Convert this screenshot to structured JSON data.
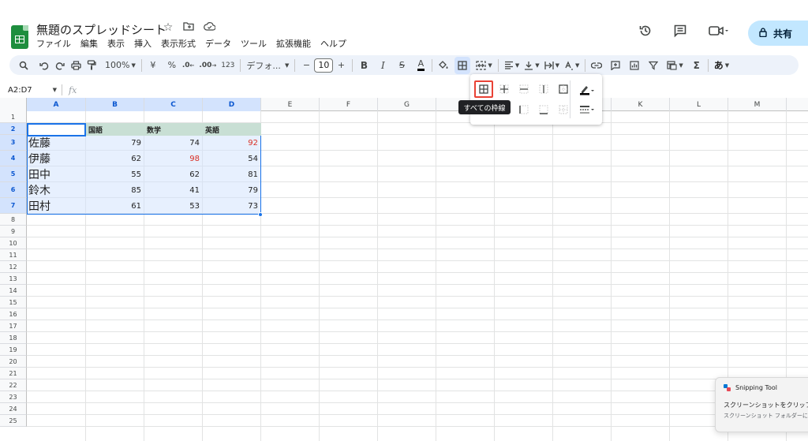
{
  "doc": {
    "title": "無題のスプレッドシート",
    "icons": [
      "star-icon",
      "move-to-folder-icon",
      "cloud-saved-icon"
    ]
  },
  "menu": [
    "ファイル",
    "編集",
    "表示",
    "挿入",
    "表示形式",
    "データ",
    "ツール",
    "拡張機能",
    "ヘルプ"
  ],
  "header_right": {
    "share_label": "共有",
    "icons": [
      "version-history-icon",
      "comments-icon",
      "meet-icon"
    ]
  },
  "toolbar": {
    "zoom": "100%",
    "currency": "¥",
    "percent": "%",
    "dec_minus": ".0",
    "dec_plus": ".00",
    "format_123": "123",
    "font": "デフォ...",
    "minus": "−",
    "font_size": "10",
    "plus": "+",
    "bold": "B",
    "italic": "I",
    "strike": "S",
    "text_color": "A",
    "ime": "あ"
  },
  "formula_bar": {
    "name_box": "A2:D7",
    "fx": "fx"
  },
  "columns": [
    "A",
    "B",
    "C",
    "D",
    "E",
    "F",
    "G",
    "H",
    "I",
    "J",
    "K",
    "L",
    "M"
  ],
  "rows": [
    "1",
    "2",
    "3",
    "4",
    "5",
    "6",
    "7",
    "8",
    "9",
    "10",
    "11",
    "12",
    "13",
    "14",
    "15",
    "16",
    "17",
    "18",
    "19",
    "20",
    "21",
    "22",
    "23",
    "24",
    "25"
  ],
  "table": {
    "headers": [
      "",
      "国語",
      "数学",
      "英語"
    ],
    "rows": [
      {
        "name": "佐藤",
        "values": [
          "79",
          "74",
          "92"
        ],
        "red": [
          false,
          false,
          true
        ]
      },
      {
        "name": "伊藤",
        "values": [
          "62",
          "98",
          "54"
        ],
        "red": [
          false,
          true,
          false
        ]
      },
      {
        "name": "田中",
        "values": [
          "55",
          "62",
          "81"
        ],
        "red": [
          false,
          false,
          false
        ]
      },
      {
        "name": "鈴木",
        "values": [
          "85",
          "41",
          "79"
        ],
        "red": [
          false,
          false,
          false
        ]
      },
      {
        "name": "田村",
        "values": [
          "61",
          "53",
          "73"
        ],
        "red": [
          false,
          false,
          false
        ]
      }
    ]
  },
  "border_menu": {
    "tooltip": "すべての枠線"
  },
  "toast": {
    "app": "Snipping Tool",
    "line1": "スクリーンショットをクリップボードに",
    "line2": "スクリーンショット フォルダーに自動"
  },
  "colors": {
    "accent": "#1a73e8",
    "selection": "#d3e3fd",
    "header_fill": "#c8dfd4",
    "red_text": "#d93025",
    "share_bg": "#c2e7ff"
  }
}
